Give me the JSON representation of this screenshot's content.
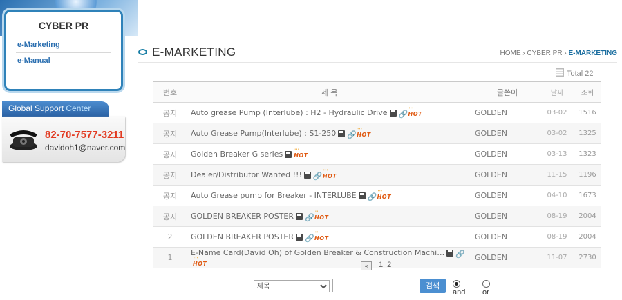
{
  "sidebar": {
    "title": "CYBER PR",
    "items": [
      {
        "label": "e-Marketing"
      },
      {
        "label": "e-Manual"
      }
    ]
  },
  "support": {
    "tab_prefix": "Global Support ",
    "tab_highlight": "Center",
    "phone": "82-70-7577-3211",
    "email": "davidoh1@naver.com"
  },
  "header": {
    "title": "E-MARKETING",
    "breadcrumb": {
      "home": "HOME",
      "section": "CYBER PR",
      "current": "E-MARKETING"
    }
  },
  "total_label": "Total 22",
  "columns": {
    "no": "번호",
    "title": "제      목",
    "author": "글쓴이",
    "date": "날짜",
    "views": "조회"
  },
  "rows": [
    {
      "no": "공지",
      "title": "Auto grease Pump (Interlube) : H2 - Hydraulic Drive",
      "author": "GOLDEN",
      "date": "03-02",
      "views": "1516"
    },
    {
      "no": "공지",
      "title": "Auto Grease Pump(Interlube) : S1-250",
      "author": "GOLDEN",
      "date": "03-02",
      "views": "1325"
    },
    {
      "no": "공지",
      "title": "Golden Breaker G series",
      "author": "GOLDEN",
      "date": "03-13",
      "views": "1323"
    },
    {
      "no": "공지",
      "title": "Dealer/Distributor Wanted !!!",
      "author": "GOLDEN",
      "date": "11-15",
      "views": "1196"
    },
    {
      "no": "공지",
      "title": "Auto Grease pump for Breaker - INTERLUBE",
      "author": "GOLDEN",
      "date": "04-10",
      "views": "1673"
    },
    {
      "no": "공지",
      "title": "GOLDEN BREAKER POSTER",
      "author": "GOLDEN",
      "date": "08-19",
      "views": "2004"
    },
    {
      "no": "2",
      "title": "GOLDEN BREAKER POSTER",
      "author": "GOLDEN",
      "date": "08-19",
      "views": "2004"
    },
    {
      "no": "1",
      "title": "E-Name Card(David Oh) of Golden Breaker & Construction Machi…",
      "author": "GOLDEN",
      "date": "11-07",
      "views": "2730"
    }
  ],
  "hot_label": "HOT",
  "icons": {
    "file": "disk-icon",
    "link": "link-icon",
    "prev": "double-left-arrow-icon",
    "phone": "telephone-icon"
  },
  "pagination": {
    "prev": "«",
    "pages": [
      "1",
      "2"
    ]
  },
  "search": {
    "field_option": "제목",
    "query": "",
    "button": "검색",
    "and_label": "and",
    "or_label": "or",
    "selected": "and"
  }
}
